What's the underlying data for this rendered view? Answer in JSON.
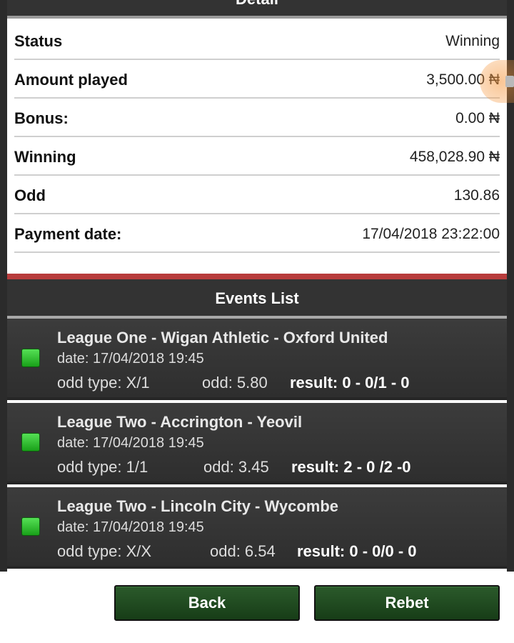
{
  "detail": {
    "header": "Detail",
    "rows": [
      {
        "label": "Status",
        "value": "Winning"
      },
      {
        "label": "Amount played",
        "value": "3,500.00 ₦"
      },
      {
        "label": "Bonus:",
        "value": "0.00 ₦"
      },
      {
        "label": "Winning",
        "value": "458,028.90 ₦"
      },
      {
        "label": "Odd",
        "value": "130.86"
      },
      {
        "label": "Payment date:",
        "value": "17/04/2018 23:22:00"
      }
    ]
  },
  "events": {
    "header": "Events List",
    "items": [
      {
        "title": "League One - Wigan Athletic - Oxford  United",
        "date": "date: 17/04/2018 19:45",
        "odd_type": "odd type: X/1",
        "odd": "odd: 5.80",
        "result": "result: 0 - 0/1 - 0",
        "status_color": "#22b022"
      },
      {
        "title": "League Two - Accrington - Yeovil",
        "date": "date: 17/04/2018 19:45",
        "odd_type": "odd type: 1/1",
        "odd": "odd: 3.45",
        "result": "result: 2 - 0 /2 -0",
        "status_color": "#22b022"
      },
      {
        "title": "League Two - Lincoln City - Wycombe",
        "date": "date: 17/04/2018 19:45",
        "odd_type": "odd type: X/X",
        "odd": "odd: 6.54",
        "result": "result: 0 - 0/0 - 0",
        "status_color": "#22b022"
      }
    ]
  },
  "buttons": {
    "back": "Back",
    "rebet": "Rebet"
  },
  "overlay": {
    "icon": "speaker-icon"
  },
  "colors": {
    "accent_red": "#b83c3c",
    "button_green": "#1f4a1f",
    "panel_dark": "#333333"
  }
}
